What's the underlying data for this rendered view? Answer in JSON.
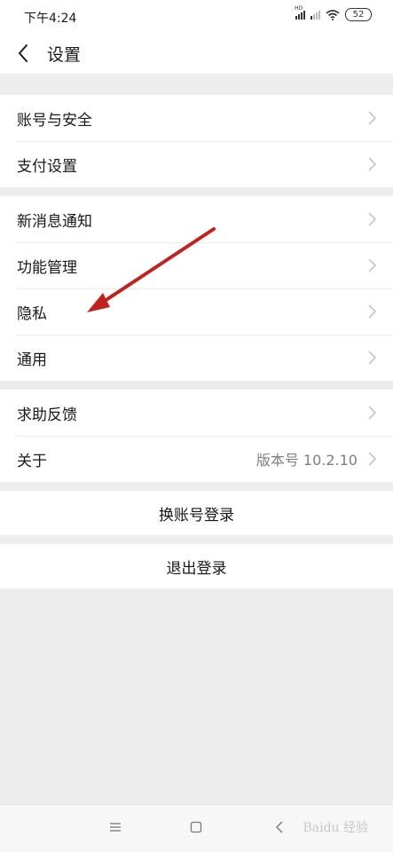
{
  "status_bar": {
    "time": "下午4:24",
    "signal_label": "HD",
    "battery": "52"
  },
  "nav": {
    "title": "设置"
  },
  "groups": [
    {
      "items": [
        {
          "label": "账号与安全"
        },
        {
          "label": "支付设置"
        }
      ]
    },
    {
      "items": [
        {
          "label": "新消息通知"
        },
        {
          "label": "功能管理"
        },
        {
          "label": "隐私"
        },
        {
          "label": "通用"
        }
      ]
    },
    {
      "items": [
        {
          "label": "求助反馈"
        },
        {
          "label": "关于",
          "value": "版本号 10.2.10"
        }
      ]
    }
  ],
  "actions": {
    "switch_account": "换账号登录",
    "logout": "退出登录"
  },
  "annotation": {
    "arrow_color": "#c0231f"
  },
  "watermark": "Baidu 经验"
}
